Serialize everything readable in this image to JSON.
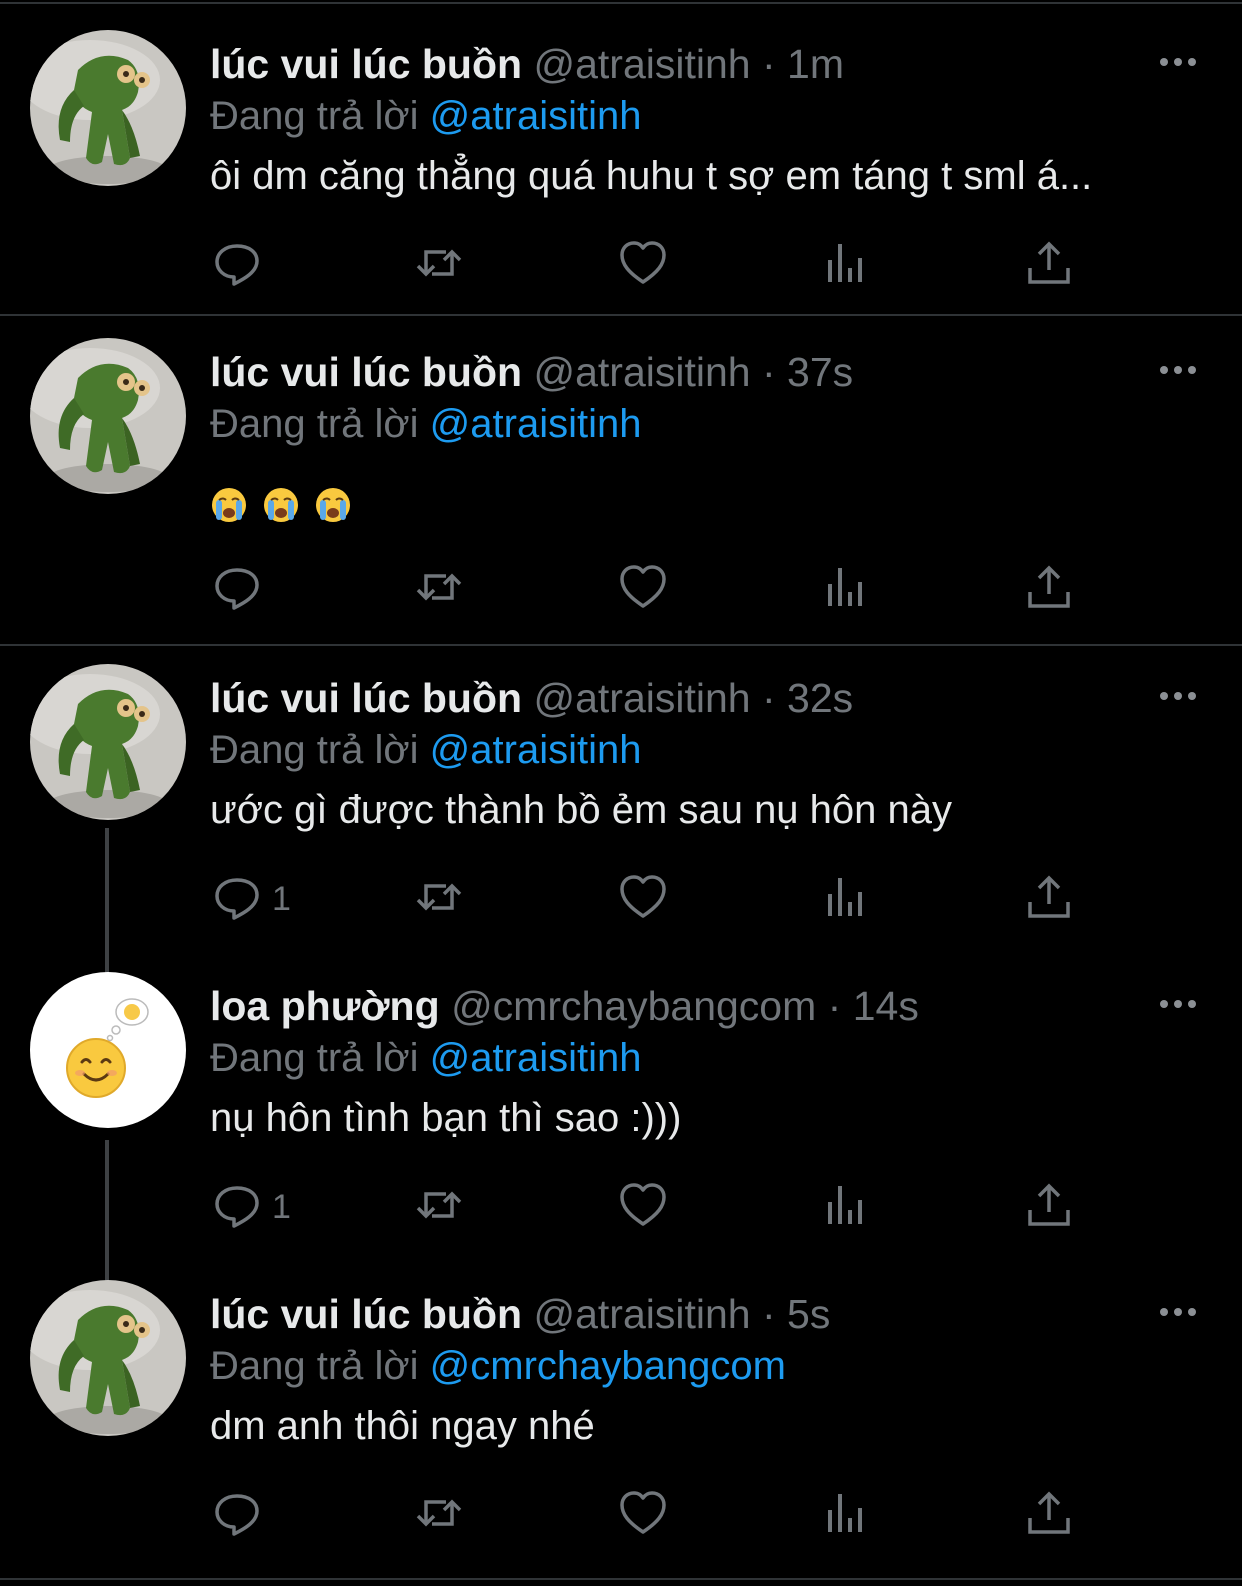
{
  "colors": {
    "background": "#000000",
    "text": "#e7e9ea",
    "muted": "#71767b",
    "link": "#1d9bf0",
    "divider": "#2f3336"
  },
  "replying_label": "Đang trả lời",
  "tweets": [
    {
      "name": "lúc vui lúc buồn",
      "handle": "@atraisitinh",
      "dot": "·",
      "time": "1m",
      "reply_to": "@atraisitinh",
      "text": "ôi dm căng thẳng quá huhu t sợ em táng t sml á...",
      "reply_count": "",
      "avatar": "frog-avatar"
    },
    {
      "name": "lúc vui lúc buồn",
      "handle": "@atraisitinh",
      "dot": "·",
      "time": "37s",
      "reply_to": "@atraisitinh",
      "text": "",
      "emojis": [
        "loudly-crying-face-emoji",
        "loudly-crying-face-emoji",
        "loudly-crying-face-emoji"
      ],
      "reply_count": "",
      "avatar": "frog-avatar"
    },
    {
      "name": "lúc vui lúc buồn",
      "handle": "@atraisitinh",
      "dot": "·",
      "time": "32s",
      "reply_to": "@atraisitinh",
      "text": "ước gì được thành bồ ẻm sau nụ hôn này",
      "reply_count": "1",
      "avatar": "frog-avatar"
    },
    {
      "name": "loa phường",
      "handle": "@cmrchaybangcom",
      "dot": "·",
      "time": "14s",
      "reply_to": "@atraisitinh",
      "text": "nụ hôn tình bạn thì sao :)))",
      "reply_count": "1",
      "avatar": "smiley-avatar"
    },
    {
      "name": "lúc vui lúc buồn",
      "handle": "@atraisitinh",
      "dot": "·",
      "time": "5s",
      "reply_to": "@cmrchaybangcom",
      "text": "dm anh thôi ngay nhé",
      "reply_count": "",
      "avatar": "frog-avatar"
    }
  ],
  "action_icons": [
    "reply-icon",
    "retweet-icon",
    "like-icon",
    "views-icon",
    "share-icon"
  ]
}
